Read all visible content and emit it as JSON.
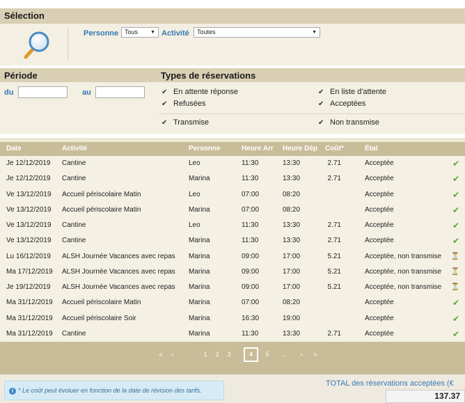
{
  "selection": {
    "title": "Sélection",
    "personne_label": "Personne",
    "personne_value": "Tous",
    "activite_label": "Activité",
    "activite_value": "Toutes",
    "search_icon": "magnifier-icon"
  },
  "periode": {
    "title": "Période",
    "du_label": "du",
    "au_label": "au",
    "du_value": "",
    "au_value": ""
  },
  "types": {
    "title": "Types de réservations",
    "options": [
      {
        "label": "En attente réponse",
        "checked": true
      },
      {
        "label": "En liste d'attente",
        "checked": true
      },
      {
        "label": "Refusées",
        "checked": true
      },
      {
        "label": "Acceptées",
        "checked": true
      },
      {
        "label": "Transmise",
        "checked": true
      },
      {
        "label": "Non transmise",
        "checked": true
      }
    ]
  },
  "table": {
    "headers": [
      "Date",
      "Activité",
      "Personne",
      "Heure Arr",
      "Heure Dép",
      "Coût*",
      "État"
    ],
    "rows": [
      {
        "date": "Je 12/12/2019",
        "activite": "Cantine",
        "personne": "Leo",
        "arr": "11:30",
        "dep": "13:30",
        "cout": "2.71",
        "etat": "Acceptée",
        "status": "ok"
      },
      {
        "date": "Je 12/12/2019",
        "activite": "Cantine",
        "personne": "Marina",
        "arr": "11:30",
        "dep": "13:30",
        "cout": "2.71",
        "etat": "Acceptée",
        "status": "ok"
      },
      {
        "date": "Ve 13/12/2019",
        "activite": "Accueil périscolaire Matin",
        "personne": "Leo",
        "arr": "07:00",
        "dep": "08:20",
        "cout": "",
        "etat": "Acceptée",
        "status": "ok"
      },
      {
        "date": "Ve 13/12/2019",
        "activite": "Accueil périscolaire Matin",
        "personne": "Marina",
        "arr": "07:00",
        "dep": "08:20",
        "cout": "",
        "etat": "Acceptée",
        "status": "ok"
      },
      {
        "date": "Ve 13/12/2019",
        "activite": "Cantine",
        "personne": "Leo",
        "arr": "11:30",
        "dep": "13:30",
        "cout": "2.71",
        "etat": "Acceptée",
        "status": "ok"
      },
      {
        "date": "Ve 13/12/2019",
        "activite": "Cantine",
        "personne": "Marina",
        "arr": "11:30",
        "dep": "13:30",
        "cout": "2.71",
        "etat": "Acceptée",
        "status": "ok"
      },
      {
        "date": "Lu 16/12/2019",
        "activite": "ALSH Journée Vacances avec repas",
        "personne": "Marina",
        "arr": "09:00",
        "dep": "17:00",
        "cout": "5.21",
        "etat": "Acceptée, non transmise",
        "status": "wait"
      },
      {
        "date": "Ma 17/12/2019",
        "activite": "ALSH Journée Vacances avec repas",
        "personne": "Marina",
        "arr": "09:00",
        "dep": "17:00",
        "cout": "5.21",
        "etat": "Acceptée, non transmise",
        "status": "wait"
      },
      {
        "date": "Je 19/12/2019",
        "activite": "ALSH Journée Vacances avec repas",
        "personne": "Marina",
        "arr": "09:00",
        "dep": "17:00",
        "cout": "5.21",
        "etat": "Acceptée, non transmise",
        "status": "wait"
      },
      {
        "date": "Ma 31/12/2019",
        "activite": "Accueil périscolaire Matin",
        "personne": "Marina",
        "arr": "07:00",
        "dep": "08:20",
        "cout": "",
        "etat": "Acceptée",
        "status": "ok"
      },
      {
        "date": "Ma 31/12/2019",
        "activite": "Accueil périscolaire Soir",
        "personne": "Marina",
        "arr": "16:30",
        "dep": "19:00",
        "cout": "",
        "etat": "Acceptée",
        "status": "ok"
      },
      {
        "date": "Ma 31/12/2019",
        "activite": "Cantine",
        "personne": "Marina",
        "arr": "11:30",
        "dep": "13:30",
        "cout": "2.71",
        "etat": "Acceptée",
        "status": "ok"
      }
    ]
  },
  "pagination": {
    "first": "«",
    "prev": "‹",
    "pages": [
      "1",
      "2",
      "3",
      "4",
      "5"
    ],
    "current": "4",
    "ellipsis": "...",
    "next": "›",
    "last": "»"
  },
  "footer": {
    "note": "* Le coût peut évoluer en fonction de la date de révision des tarifs.",
    "total_label": "TOTAL des réservations acceptées (€",
    "total_value": "137.37"
  },
  "colors": {
    "header_band": "#d8cfb4",
    "table_header": "#c9bc98",
    "accent_blue": "#3478b5",
    "ok_green": "#5aa33c",
    "wait_orange": "#e0952b"
  }
}
